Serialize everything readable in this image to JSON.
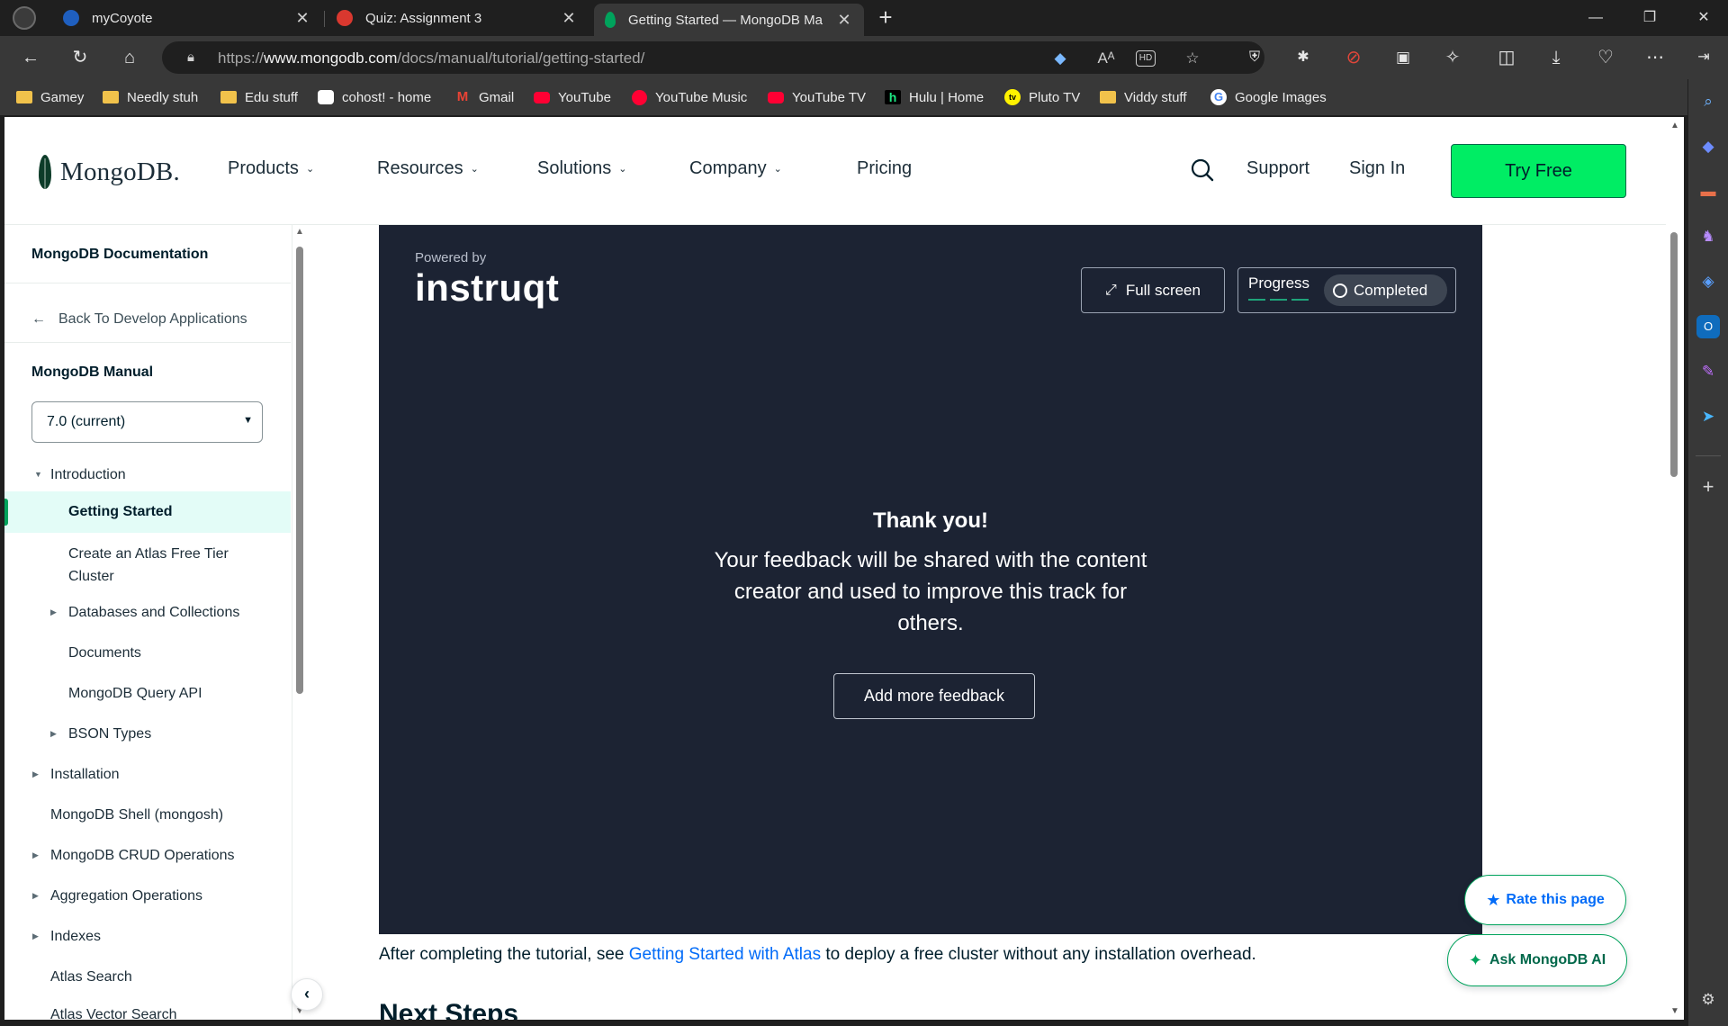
{
  "browser": {
    "tabs": [
      {
        "title": "myCoyote",
        "close": "✕"
      },
      {
        "title": "Quiz: Assignment 3",
        "close": "✕"
      },
      {
        "title": "Getting Started — MongoDB Ma",
        "close": "✕"
      }
    ],
    "new_tab": "+",
    "window_controls": {
      "minimize": "—",
      "maximize": "❐",
      "close": "✕"
    },
    "url_prefix": "https://",
    "url_host": "www.mongodb.com",
    "url_path": "/docs/manual/tutorial/getting-started/",
    "bookmarks": [
      {
        "label": "Gamey",
        "icon": "folder-icon"
      },
      {
        "label": "Needly stuh",
        "icon": "folder-icon"
      },
      {
        "label": "Edu stuff",
        "icon": "folder-icon"
      },
      {
        "label": "cohost! - home",
        "icon": "cohost-icon"
      },
      {
        "label": "Gmail",
        "icon": "gmail-icon"
      },
      {
        "label": "YouTube",
        "icon": "youtube-icon"
      },
      {
        "label": "YouTube Music",
        "icon": "youtube-music-icon"
      },
      {
        "label": "YouTube TV",
        "icon": "youtube-icon"
      },
      {
        "label": "Hulu | Home",
        "icon": "hulu-icon"
      },
      {
        "label": "Pluto TV",
        "icon": "pluto-tv-icon"
      },
      {
        "label": "Viddy stuff",
        "icon": "folder-icon"
      },
      {
        "label": "Google Images",
        "icon": "google-icon"
      }
    ],
    "url_icons": {
      "hd": "HD"
    }
  },
  "site_nav": {
    "logo": "MongoDB.",
    "items": [
      "Products",
      "Resources",
      "Solutions",
      "Company",
      "Pricing"
    ],
    "support": "Support",
    "sign_in": "Sign In",
    "try_free": "Try Free"
  },
  "sidebar": {
    "docs_title": "MongoDB Documentation",
    "back": "Back To Develop Applications",
    "manual_title": "MongoDB Manual",
    "version": "7.0 (current)",
    "items": [
      {
        "label": "Introduction"
      },
      {
        "label": "Getting Started"
      },
      {
        "label": "Create an Atlas Free Tier"
      },
      {
        "label": "Cluster"
      },
      {
        "label": "Databases and Collections"
      },
      {
        "label": "Documents"
      },
      {
        "label": "MongoDB Query API"
      },
      {
        "label": "BSON Types"
      },
      {
        "label": "Installation"
      },
      {
        "label": "MongoDB Shell (mongosh)"
      },
      {
        "label": "MongoDB CRUD Operations"
      },
      {
        "label": "Aggregation Operations"
      },
      {
        "label": "Indexes"
      },
      {
        "label": "Atlas Search"
      },
      {
        "label": "Atlas Vector Search"
      }
    ]
  },
  "instruqt": {
    "powered_by": "Powered by",
    "brand": "instruqt",
    "full_screen": "Full screen",
    "progress": "Progress",
    "progress_state": "Completed",
    "thanks": "Thank you!",
    "feedback_message": "Your feedback will be shared with the content creator and used to improve this track for others.",
    "add_feedback": "Add more feedback"
  },
  "content": {
    "after_prefix": "After completing the tutorial, see ",
    "after_link": "Getting Started with Atlas",
    "after_suffix": " to deploy a free cluster without any installation overhead.",
    "next_heading": "Next Steps"
  },
  "floating": {
    "rate": "Rate this page",
    "ask": "Ask MongoDB AI"
  },
  "colors": {
    "mongodb_green": "#00ed64",
    "instruqt_bg": "#1c2333",
    "link_blue": "#016bf8",
    "active_nav_bg": "#e3fcf7"
  }
}
